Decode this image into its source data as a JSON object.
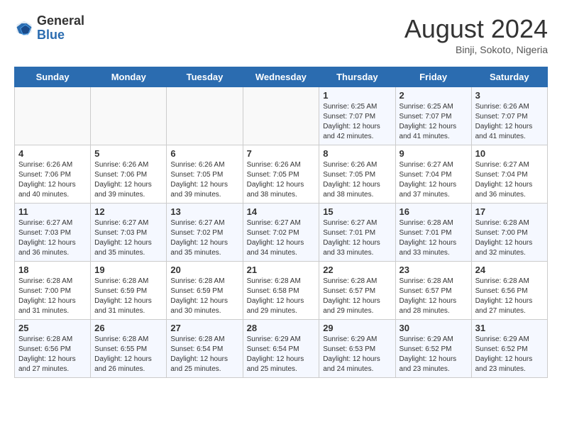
{
  "header": {
    "logo_general": "General",
    "logo_blue": "Blue",
    "month_year": "August 2024",
    "location": "Binji, Sokoto, Nigeria"
  },
  "weekdays": [
    "Sunday",
    "Monday",
    "Tuesday",
    "Wednesday",
    "Thursday",
    "Friday",
    "Saturday"
  ],
  "weeks": [
    [
      {
        "day": "",
        "info": ""
      },
      {
        "day": "",
        "info": ""
      },
      {
        "day": "",
        "info": ""
      },
      {
        "day": "",
        "info": ""
      },
      {
        "day": "1",
        "info": "Sunrise: 6:25 AM\nSunset: 7:07 PM\nDaylight: 12 hours\nand 42 minutes."
      },
      {
        "day": "2",
        "info": "Sunrise: 6:25 AM\nSunset: 7:07 PM\nDaylight: 12 hours\nand 41 minutes."
      },
      {
        "day": "3",
        "info": "Sunrise: 6:26 AM\nSunset: 7:07 PM\nDaylight: 12 hours\nand 41 minutes."
      }
    ],
    [
      {
        "day": "4",
        "info": "Sunrise: 6:26 AM\nSunset: 7:06 PM\nDaylight: 12 hours\nand 40 minutes."
      },
      {
        "day": "5",
        "info": "Sunrise: 6:26 AM\nSunset: 7:06 PM\nDaylight: 12 hours\nand 39 minutes."
      },
      {
        "day": "6",
        "info": "Sunrise: 6:26 AM\nSunset: 7:05 PM\nDaylight: 12 hours\nand 39 minutes."
      },
      {
        "day": "7",
        "info": "Sunrise: 6:26 AM\nSunset: 7:05 PM\nDaylight: 12 hours\nand 38 minutes."
      },
      {
        "day": "8",
        "info": "Sunrise: 6:26 AM\nSunset: 7:05 PM\nDaylight: 12 hours\nand 38 minutes."
      },
      {
        "day": "9",
        "info": "Sunrise: 6:27 AM\nSunset: 7:04 PM\nDaylight: 12 hours\nand 37 minutes."
      },
      {
        "day": "10",
        "info": "Sunrise: 6:27 AM\nSunset: 7:04 PM\nDaylight: 12 hours\nand 36 minutes."
      }
    ],
    [
      {
        "day": "11",
        "info": "Sunrise: 6:27 AM\nSunset: 7:03 PM\nDaylight: 12 hours\nand 36 minutes."
      },
      {
        "day": "12",
        "info": "Sunrise: 6:27 AM\nSunset: 7:03 PM\nDaylight: 12 hours\nand 35 minutes."
      },
      {
        "day": "13",
        "info": "Sunrise: 6:27 AM\nSunset: 7:02 PM\nDaylight: 12 hours\nand 35 minutes."
      },
      {
        "day": "14",
        "info": "Sunrise: 6:27 AM\nSunset: 7:02 PM\nDaylight: 12 hours\nand 34 minutes."
      },
      {
        "day": "15",
        "info": "Sunrise: 6:27 AM\nSunset: 7:01 PM\nDaylight: 12 hours\nand 33 minutes."
      },
      {
        "day": "16",
        "info": "Sunrise: 6:28 AM\nSunset: 7:01 PM\nDaylight: 12 hours\nand 33 minutes."
      },
      {
        "day": "17",
        "info": "Sunrise: 6:28 AM\nSunset: 7:00 PM\nDaylight: 12 hours\nand 32 minutes."
      }
    ],
    [
      {
        "day": "18",
        "info": "Sunrise: 6:28 AM\nSunset: 7:00 PM\nDaylight: 12 hours\nand 31 minutes."
      },
      {
        "day": "19",
        "info": "Sunrise: 6:28 AM\nSunset: 6:59 PM\nDaylight: 12 hours\nand 31 minutes."
      },
      {
        "day": "20",
        "info": "Sunrise: 6:28 AM\nSunset: 6:59 PM\nDaylight: 12 hours\nand 30 minutes."
      },
      {
        "day": "21",
        "info": "Sunrise: 6:28 AM\nSunset: 6:58 PM\nDaylight: 12 hours\nand 29 minutes."
      },
      {
        "day": "22",
        "info": "Sunrise: 6:28 AM\nSunset: 6:57 PM\nDaylight: 12 hours\nand 29 minutes."
      },
      {
        "day": "23",
        "info": "Sunrise: 6:28 AM\nSunset: 6:57 PM\nDaylight: 12 hours\nand 28 minutes."
      },
      {
        "day": "24",
        "info": "Sunrise: 6:28 AM\nSunset: 6:56 PM\nDaylight: 12 hours\nand 27 minutes."
      }
    ],
    [
      {
        "day": "25",
        "info": "Sunrise: 6:28 AM\nSunset: 6:56 PM\nDaylight: 12 hours\nand 27 minutes."
      },
      {
        "day": "26",
        "info": "Sunrise: 6:28 AM\nSunset: 6:55 PM\nDaylight: 12 hours\nand 26 minutes."
      },
      {
        "day": "27",
        "info": "Sunrise: 6:28 AM\nSunset: 6:54 PM\nDaylight: 12 hours\nand 25 minutes."
      },
      {
        "day": "28",
        "info": "Sunrise: 6:29 AM\nSunset: 6:54 PM\nDaylight: 12 hours\nand 25 minutes."
      },
      {
        "day": "29",
        "info": "Sunrise: 6:29 AM\nSunset: 6:53 PM\nDaylight: 12 hours\nand 24 minutes."
      },
      {
        "day": "30",
        "info": "Sunrise: 6:29 AM\nSunset: 6:52 PM\nDaylight: 12 hours\nand 23 minutes."
      },
      {
        "day": "31",
        "info": "Sunrise: 6:29 AM\nSunset: 6:52 PM\nDaylight: 12 hours\nand 23 minutes."
      }
    ]
  ]
}
